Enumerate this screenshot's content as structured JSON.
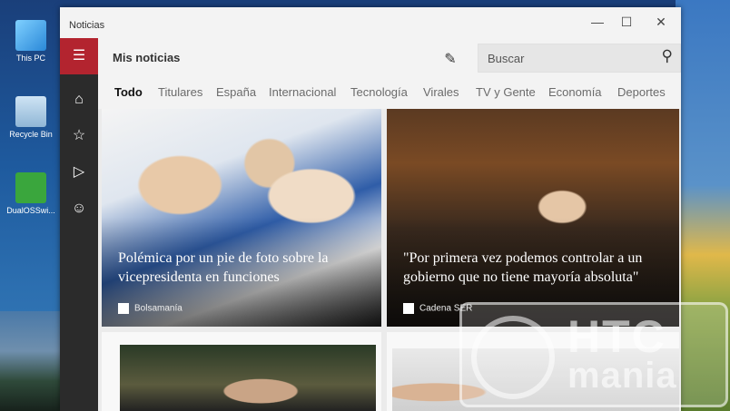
{
  "window": {
    "title": "Noticias",
    "controls": {
      "minimize": "—",
      "maximize": "☐",
      "close": "✕"
    }
  },
  "desktop": {
    "icons": [
      {
        "label": "This PC",
        "icon": "computer-icon"
      },
      {
        "label": "Recycle Bin",
        "icon": "recycle-bin-icon"
      },
      {
        "label": "DualOSSwi...",
        "icon": "android-icon"
      }
    ]
  },
  "rail": {
    "items": [
      {
        "icon": "hamburger-icon",
        "glyph": "☰"
      },
      {
        "icon": "home-icon",
        "glyph": "⌂"
      },
      {
        "icon": "favorites-icon",
        "glyph": "☆"
      },
      {
        "icon": "play-icon",
        "glyph": "▷"
      },
      {
        "icon": "feedback-icon",
        "glyph": "☺"
      }
    ]
  },
  "header": {
    "app_name": "Mis noticias",
    "edit_glyph": "✎",
    "more_glyph": "···",
    "search_placeholder": "Buscar",
    "search_glyph": "⚲"
  },
  "tabs": [
    {
      "label": "Todo",
      "active": true
    },
    {
      "label": "Titulares",
      "active": false
    },
    {
      "label": "España",
      "active": false
    },
    {
      "label": "Internacional",
      "active": false
    },
    {
      "label": "Tecnología",
      "active": false
    },
    {
      "label": "Virales",
      "active": false
    },
    {
      "label": "TV y Gente",
      "active": false
    },
    {
      "label": "Economía",
      "active": false
    },
    {
      "label": "Deportes",
      "active": false
    }
  ],
  "articles": [
    {
      "title": "Polémica por un pie de foto sobre la vicepresidenta en funciones",
      "source": "Bolsamanía"
    },
    {
      "title": "\"Por primera vez podemos controlar a un gobierno que no tiene mayoría absoluta\"",
      "source": "Cadena SER"
    }
  ],
  "watermark": {
    "line1": "HTC",
    "line2": "mania"
  },
  "colors": {
    "accent": "#b3242f",
    "rail": "#2b2b2b",
    "background": "#f3f3f3"
  }
}
